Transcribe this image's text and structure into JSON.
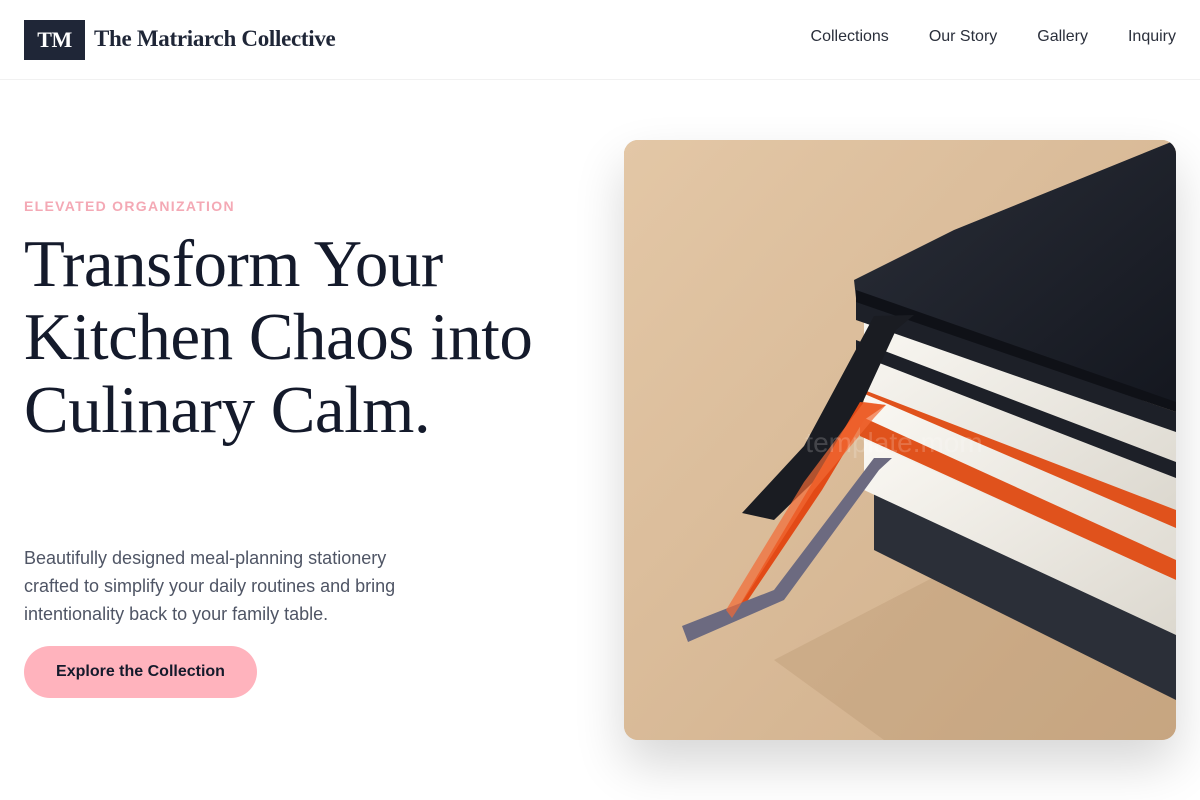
{
  "brand": {
    "logo_mark": "TM",
    "name": "The Matriarch Collective"
  },
  "nav": {
    "items": [
      {
        "label": "Collections"
      },
      {
        "label": "Our Story"
      },
      {
        "label": "Gallery"
      },
      {
        "label": "Inquiry"
      }
    ]
  },
  "hero": {
    "eyebrow": "ELEVATED ORGANIZATION",
    "headline": "Transform Your Kitchen Chaos into Culinary Calm.",
    "subtext": "Beautifully designed meal-planning stationery crafted to simplify your daily routines and bring intentionality back to your family table.",
    "cta_label": "Explore the Collection",
    "image_watermark": "template.mom"
  },
  "colors": {
    "primary_dark": "#1f2637",
    "accent_pink": "#ffb3bd",
    "eyebrow_pink": "#f4a9b5"
  }
}
